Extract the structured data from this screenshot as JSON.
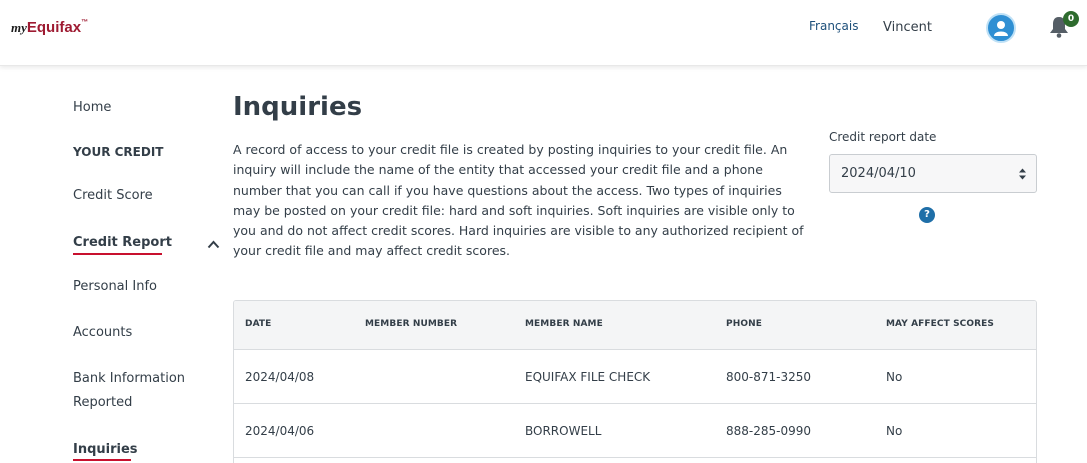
{
  "header": {
    "logo_my": "my",
    "logo_brand": "Equifax",
    "logo_tm": "™",
    "language_link": "Français",
    "user_name": "Vincent",
    "notification_count": "0"
  },
  "sidebar": {
    "items": [
      {
        "label": "Home"
      },
      {
        "label": "YOUR CREDIT"
      },
      {
        "label": "Credit Score"
      },
      {
        "label": "Credit Report"
      },
      {
        "label": "Personal Info"
      },
      {
        "label": "Accounts"
      },
      {
        "label": "Bank Information"
      },
      {
        "label": "Reported"
      },
      {
        "label": "Inquiries"
      }
    ]
  },
  "main": {
    "title": "Inquiries",
    "description": "A record of access to your credit file is created by posting inquiries to your credit file. An inquiry will include the name of the entity that accessed your credit file and a phone number that you can call if you have questions about the access. Two types of inquiries may be posted on your credit file: hard and soft inquiries. Soft inquiries are visible only to you and do not affect credit scores. Hard inquiries are visible to any authorized recipient of your credit file and may affect credit scores.",
    "date_label": "Credit report date",
    "date_value": "2024/04/10",
    "help_glyph": "?"
  },
  "table": {
    "headers": [
      "DATE",
      "MEMBER NUMBER",
      "MEMBER NAME",
      "PHONE",
      "MAY AFFECT SCORES"
    ],
    "rows": [
      {
        "date": "2024/04/08",
        "member_number": "",
        "member_name": "EQUIFAX FILE CHECK",
        "phone": "800-871-3250",
        "may_affect": "No"
      },
      {
        "date": "2024/04/06",
        "member_number": "",
        "member_name": "BORROWELL",
        "phone": "888-285-0990",
        "may_affect": "No"
      }
    ]
  },
  "colors": {
    "brand": "#9e1b32",
    "accent_underline": "#c8102e",
    "link": "#1d4f7a",
    "avatar": "#2f8fd3",
    "badge": "#2e6b2e"
  }
}
